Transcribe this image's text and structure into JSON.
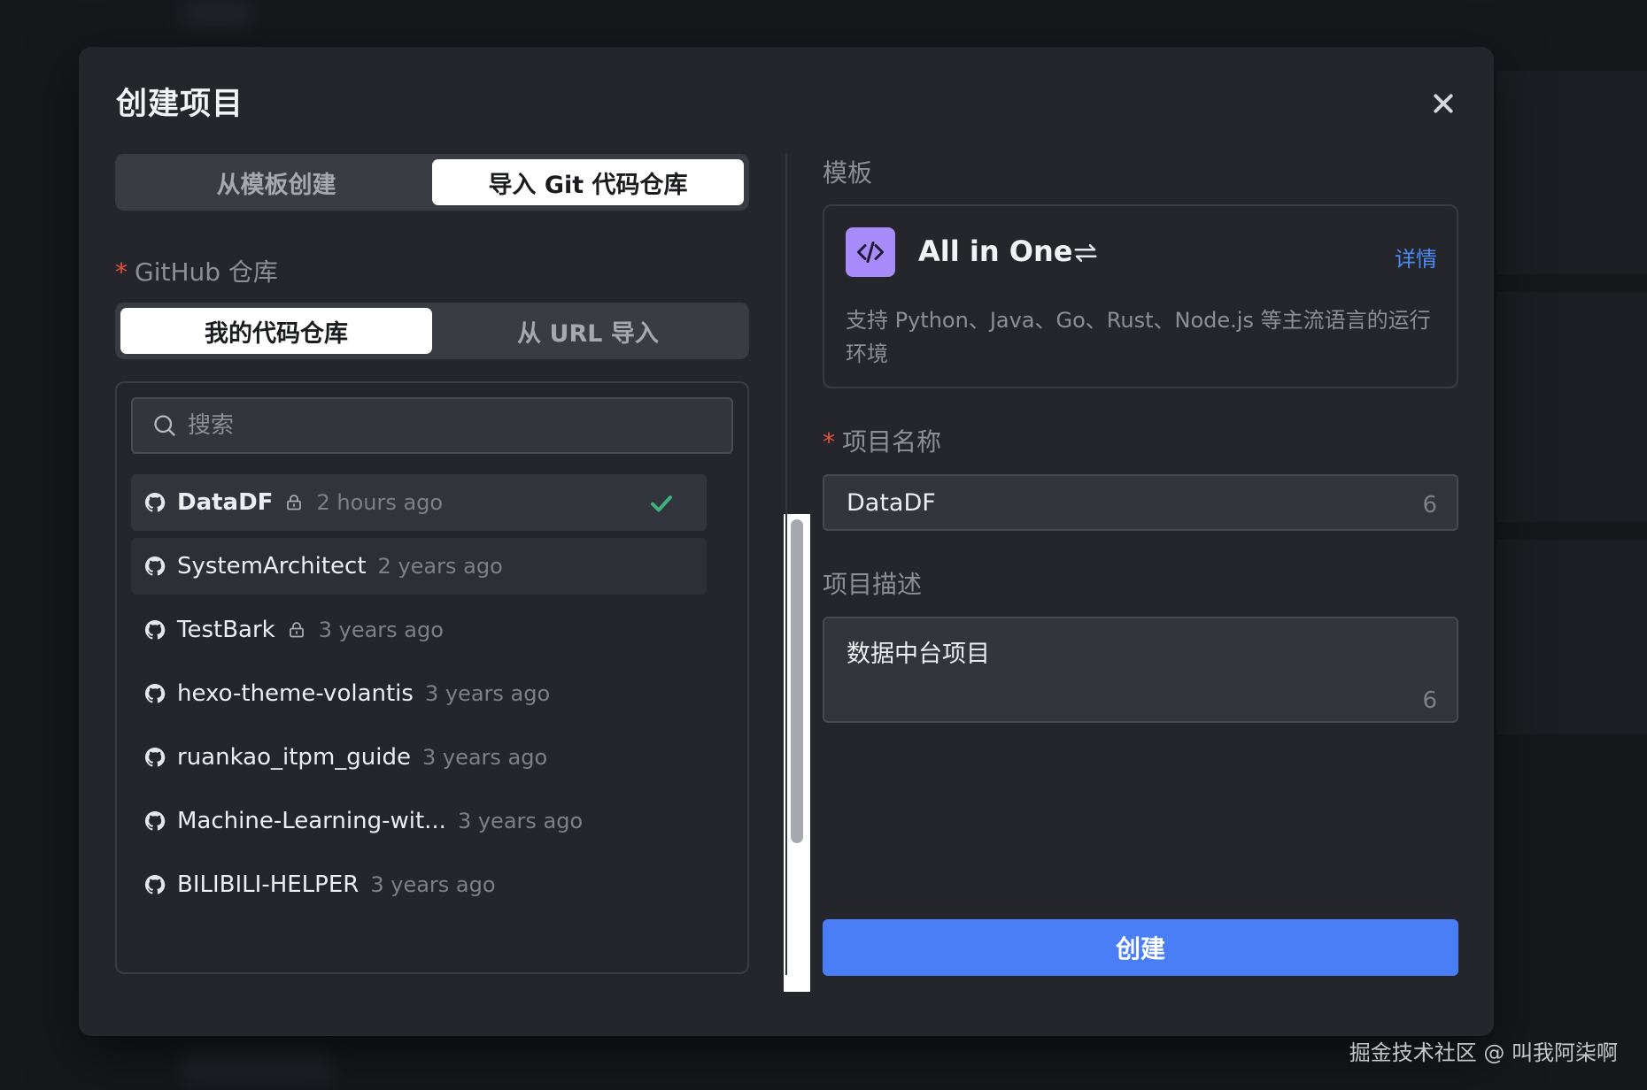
{
  "modal": {
    "title": "创建项目",
    "close_icon": "close-icon"
  },
  "source_tabs": [
    {
      "label": "从模板创建",
      "active": false
    },
    {
      "label": "导入 Git 代码仓库",
      "active": true
    }
  ],
  "github": {
    "label": "GitHub 仓库",
    "tabs": [
      {
        "label": "我的代码仓库",
        "active": true
      },
      {
        "label": "从 URL 导入",
        "active": false
      }
    ],
    "search_placeholder": "搜索",
    "repos": [
      {
        "name": "DataDF",
        "private": true,
        "time": "2 hours ago",
        "selected": true
      },
      {
        "name": "SystemArchitect",
        "private": false,
        "time": "2 years ago",
        "selected": false
      },
      {
        "name": "TestBark",
        "private": true,
        "time": "3 years ago",
        "selected": false
      },
      {
        "name": "hexo-theme-volantis",
        "private": false,
        "time": "3 years ago",
        "selected": false
      },
      {
        "name": "ruankao_itpm_guide",
        "private": false,
        "time": "3 years ago",
        "selected": false
      },
      {
        "name": "Machine-Learning-wit...",
        "private": false,
        "time": "3 years ago",
        "selected": false
      },
      {
        "name": "BILIBILI-HELPER",
        "private": false,
        "time": "3 years ago",
        "selected": false
      }
    ]
  },
  "template": {
    "label": "模板",
    "name": "All in One",
    "detail_link": "详情",
    "description": "支持 Python、Java、Go、Rust、Node.js 等主流语言的运行环境",
    "accent": "#a78bfa"
  },
  "project_name": {
    "label": "项目名称",
    "value": "DataDF",
    "count": "6"
  },
  "project_desc": {
    "label": "项目描述",
    "value": "数据中台项目",
    "count": "6"
  },
  "submit": {
    "label": "创建",
    "color": "#4a7ef6"
  },
  "watermark": "掘金技术社区 @ 叫我阿柒啊"
}
